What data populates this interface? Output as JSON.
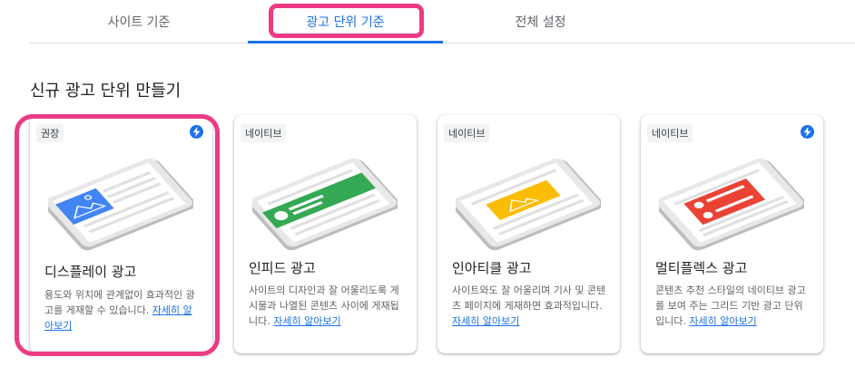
{
  "tabs": [
    {
      "label": "사이트 기준"
    },
    {
      "label": "광고 단위 기준"
    },
    {
      "label": "전체 설정"
    }
  ],
  "section_title": "신규 광고 단위 만들기",
  "cards": [
    {
      "badge": "권장",
      "title": "디스플레이 광고",
      "desc": "용도와 위치에 관계없이 효과적인 광고를 게재할 수 있습니다.",
      "link": "자세히 알아보기",
      "accent": "#4285f4",
      "bolt": true
    },
    {
      "badge": "네이티브",
      "title": "인피드 광고",
      "desc": "사이트의 디자인과 잘 어울리도록 게시물과 나열된 콘텐츠 사이에 게재됩니다.",
      "link": "자세히 알아보기",
      "accent": "#34a853",
      "bolt": false
    },
    {
      "badge": "네이티브",
      "title": "인아티클 광고",
      "desc": "사이트와도 잘 어울리며 기사 및 콘텐츠 페이지에 게재하면 효과적입니다.",
      "link": "자세히 알아보기",
      "accent": "#fbbc04",
      "bolt": false
    },
    {
      "badge": "네이티브",
      "title": "멀티플렉스 광고",
      "desc": "콘텐츠 추천 스타일의 네이티브 광고를 보여 주는 그리드 기반 광고 단위입니다.",
      "link": "자세히 알아보기",
      "accent": "#ea4335",
      "bolt": true
    }
  ],
  "colors": {
    "active_tab": "#1a73e8",
    "highlight": "#ec3a83"
  },
  "icons": {
    "bolt": "bolt-icon"
  }
}
